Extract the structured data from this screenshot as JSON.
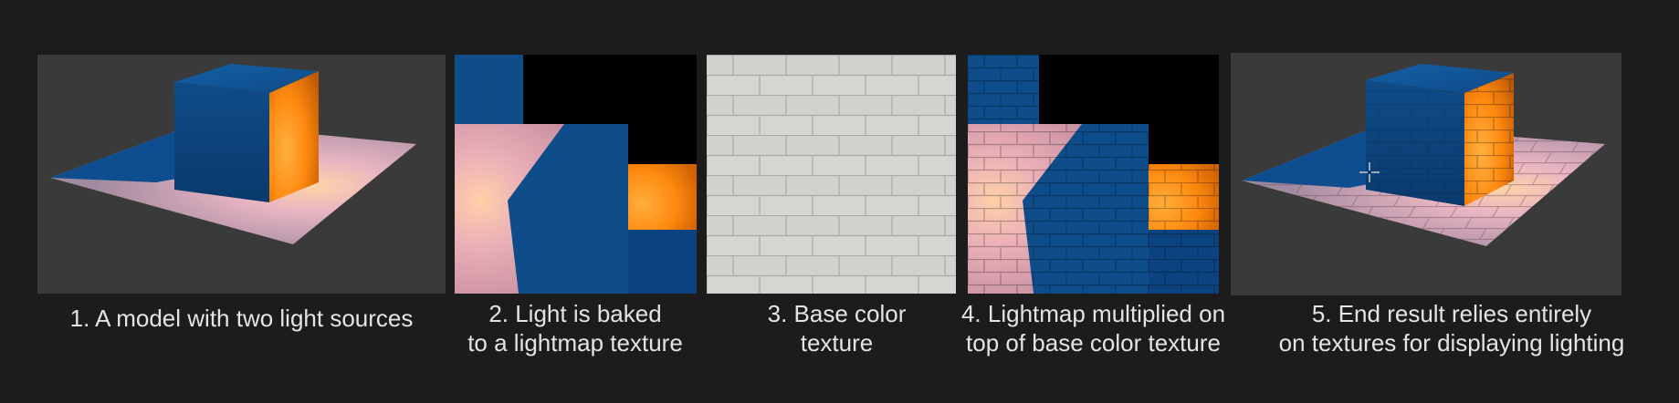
{
  "panels": [
    {
      "caption": [
        "1. A model with two light sources"
      ]
    },
    {
      "caption": [
        "2. Light is baked",
        "to a lightmap texture"
      ]
    },
    {
      "caption": [
        "3. Base color",
        "texture"
      ]
    },
    {
      "caption": [
        "4. Lightmap multiplied on",
        "top of base color texture"
      ]
    },
    {
      "caption": [
        "5. End result relies entirely",
        "on textures for displaying lighting"
      ]
    }
  ],
  "colors": {
    "background": "#1c1c1c",
    "panel_gray": "#3a3a3a",
    "cube_blue": "#0e4d8a",
    "light_orange": "#ff8a10",
    "floor_pink": "#e8b4c4",
    "brick_light": "#ddd8d0"
  }
}
